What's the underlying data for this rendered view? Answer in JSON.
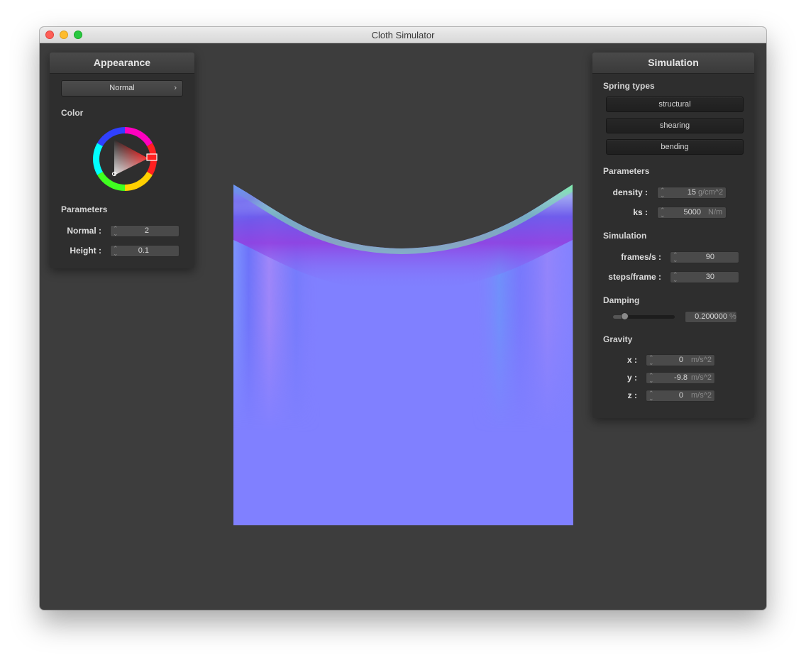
{
  "window": {
    "title": "Cloth Simulator"
  },
  "appearance": {
    "title": "Appearance",
    "shader_select": "Normal",
    "color_label": "Color",
    "color_wheel": {
      "hue": "#ff0000"
    },
    "parameters_label": "Parameters",
    "normal": {
      "label": "Normal :",
      "value": "2"
    },
    "height": {
      "label": "Height :",
      "value": "0.1"
    }
  },
  "simulation": {
    "title": "Simulation",
    "spring_types_label": "Spring types",
    "springs": [
      "structural",
      "shearing",
      "bending"
    ],
    "parameters_label": "Parameters",
    "density": {
      "label": "density :",
      "value": "15",
      "unit": "g/cm^2"
    },
    "ks": {
      "label": "ks :",
      "value": "5000",
      "unit": "N/m"
    },
    "sim_label": "Simulation",
    "fps": {
      "label": "frames/s :",
      "value": "90"
    },
    "steps": {
      "label": "steps/frame :",
      "value": "30"
    },
    "damping_label": "Damping",
    "damping": {
      "value": "0.200000",
      "unit": "%",
      "slider_fraction": 0.2
    },
    "gravity_label": "Gravity",
    "gx": {
      "label": "x :",
      "value": "0",
      "unit": "m/s^2"
    },
    "gy": {
      "label": "y :",
      "value": "-9.8",
      "unit": "m/s^2"
    },
    "gz": {
      "label": "z :",
      "value": "0",
      "unit": "m/s^2"
    }
  },
  "colors": {
    "background": "#3d3d3d",
    "panel": "#2e2e2e",
    "cloth_base": "#8080ff"
  }
}
